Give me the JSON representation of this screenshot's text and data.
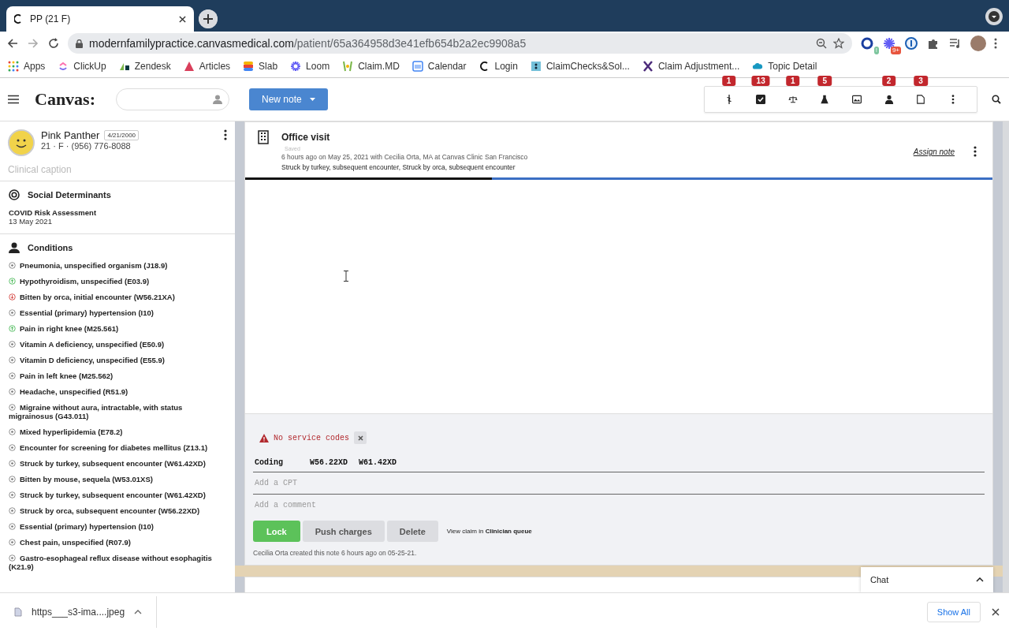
{
  "browser": {
    "tab_title": "PP (21 F)",
    "address": {
      "host": "modernfamilypractice.canvasmedical.com",
      "path": "/patient/65a364958d3e41efb654b2a2ec9908a5"
    },
    "extensions": [
      {
        "kind": "ring",
        "badge": "!"
      },
      {
        "kind": "burst",
        "badge": "9+"
      },
      {
        "kind": "key"
      },
      {
        "kind": "puzzle"
      },
      {
        "kind": "playlist"
      }
    ],
    "bookmarks": [
      {
        "label": "Apps",
        "kind": "grid"
      },
      {
        "label": "ClickUp",
        "kind": "clickup"
      },
      {
        "label": "Zendesk",
        "kind": "zendesk"
      },
      {
        "label": "Articles",
        "kind": "articles"
      },
      {
        "label": "Slab",
        "kind": "slab"
      },
      {
        "label": "Loom",
        "kind": "loom"
      },
      {
        "label": "Claim.MD",
        "kind": "claimmd"
      },
      {
        "label": "Calendar",
        "kind": "calendar"
      },
      {
        "label": "Login",
        "kind": "canvas"
      },
      {
        "label": "ClaimChecks&Sol...",
        "kind": "claimchecks"
      },
      {
        "label": "Claim Adjustment...",
        "kind": "x"
      },
      {
        "label": "Topic Detail",
        "kind": "cloud"
      }
    ]
  },
  "app": {
    "logo": "Canvas:",
    "new_note": "New note",
    "toolbar": [
      {
        "kind": "caduceus",
        "badge": "1"
      },
      {
        "kind": "task",
        "badge": "13"
      },
      {
        "kind": "scale",
        "badge": "1"
      },
      {
        "kind": "flask",
        "badge": "5"
      },
      {
        "kind": "image"
      },
      {
        "kind": "person",
        "badge": "2"
      },
      {
        "kind": "document",
        "badge": "3"
      },
      {
        "kind": "more"
      }
    ]
  },
  "patient": {
    "name": "Pink Panther",
    "dob": "4/21/2000",
    "details": "21 · F · (956) 776-8088",
    "caption_placeholder": "Clinical caption"
  },
  "social_determinants": {
    "title": "Social Determinants",
    "items": [
      {
        "name": "COVID Risk Assessment",
        "date": "13 May 2021"
      }
    ]
  },
  "conditions": {
    "title": "Conditions",
    "items": [
      {
        "name": "Pneumonia, unspecified organism (J18.9)",
        "kind": "stable"
      },
      {
        "name": "Hypothyroidism, unspecified (E03.9)",
        "kind": "improving"
      },
      {
        "name": "Bitten by orca, initial encounter (W56.21XA)",
        "kind": "worsening"
      },
      {
        "name": "Essential (primary) hypertension (I10)",
        "kind": "stable"
      },
      {
        "name": "Pain in right knee (M25.561)",
        "kind": "improving"
      },
      {
        "name": "Vitamin A deficiency, unspecified (E50.9)",
        "kind": "stable"
      },
      {
        "name": "Vitamin D deficiency, unspecified (E55.9)",
        "kind": "stable"
      },
      {
        "name": "Pain in left knee (M25.562)",
        "kind": "stable"
      },
      {
        "name": "Headache, unspecified (R51.9)",
        "kind": "stable"
      },
      {
        "name": "Migraine without aura, intractable, with status migrainosus (G43.011)",
        "kind": "stable"
      },
      {
        "name": "Mixed hyperlipidemia (E78.2)",
        "kind": "stable"
      },
      {
        "name": "Encounter for screening for diabetes mellitus (Z13.1)",
        "kind": "stable"
      },
      {
        "name": "Struck by turkey, subsequent encounter (W61.42XD)",
        "kind": "stable"
      },
      {
        "name": "Bitten by mouse, sequela (W53.01XS)",
        "kind": "stable"
      },
      {
        "name": "Struck by turkey, subsequent encounter (W61.42XD)",
        "kind": "stable"
      },
      {
        "name": "Struck by orca, subsequent encounter (W56.22XD)",
        "kind": "stable"
      },
      {
        "name": "Essential (primary) hypertension (I10)",
        "kind": "stable"
      },
      {
        "name": "Chest pain, unspecified (R07.9)",
        "kind": "stable"
      },
      {
        "name": "Gastro-esophageal reflux disease without esophagitis (K21.9)",
        "kind": "stable"
      }
    ]
  },
  "note": {
    "title": "Office visit",
    "status": "Saved",
    "meta": "6 hours ago on May 25, 2021 with Cecilia Orta, MA at Canvas Clinic San Francisco",
    "diagnoses": "Struck by turkey, subsequent encounter, Struck by orca, subsequent encounter",
    "assign": "Assign note",
    "level": 0.33
  },
  "billing": {
    "warning": "No service codes",
    "coding_label": "Coding",
    "codes": [
      "W56.22XD",
      "W61.42XD"
    ],
    "cpt_placeholder": "Add a CPT",
    "comment_placeholder": "Add a comment",
    "buttons": [
      {
        "label": "Lock",
        "kind": "primary"
      },
      {
        "label": "Push charges",
        "kind": "secondary"
      },
      {
        "label": "Delete",
        "kind": "secondary"
      }
    ],
    "claim_link": "View claim in **Clinician queue**",
    "footer": "Cecilia Orta created this note 6 hours ago on 05-25-21."
  },
  "chat": {
    "label": "Chat"
  },
  "downloads": {
    "file": "https___s3-ima....jpeg",
    "show_all": "Show All"
  }
}
